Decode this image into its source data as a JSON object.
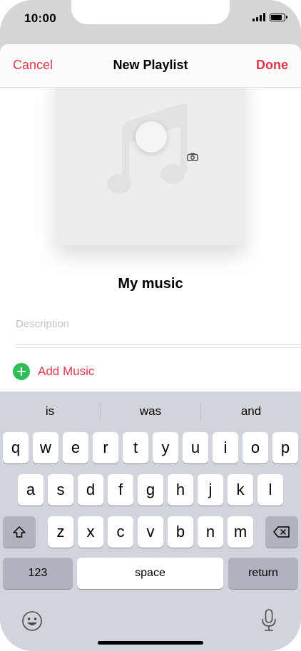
{
  "status_bar": {
    "time": "10:00"
  },
  "nav": {
    "cancel_label": "Cancel",
    "title": "New Playlist",
    "done_label": "Done"
  },
  "playlist": {
    "name": "My music",
    "description_placeholder": "Description",
    "add_music_label": "Add Music"
  },
  "keyboard": {
    "suggestions": [
      "is",
      "was",
      "and"
    ],
    "row1": [
      "q",
      "w",
      "e",
      "r",
      "t",
      "y",
      "u",
      "i",
      "o",
      "p"
    ],
    "row2": [
      "a",
      "s",
      "d",
      "f",
      "g",
      "h",
      "j",
      "k",
      "l"
    ],
    "row3": [
      "z",
      "x",
      "c",
      "v",
      "b",
      "n",
      "m"
    ],
    "numbers_label": "123",
    "space_label": "space",
    "return_label": "return"
  },
  "colors": {
    "accent": "#e3354a",
    "add_green": "#2fbd56",
    "keyboard_bg": "#d1d4db"
  },
  "icons": [
    "signal-icon",
    "battery-icon",
    "music-note-icon",
    "camera-icon",
    "add-circle-icon",
    "shift-icon",
    "delete-icon",
    "emoji-icon",
    "microphone-icon"
  ]
}
